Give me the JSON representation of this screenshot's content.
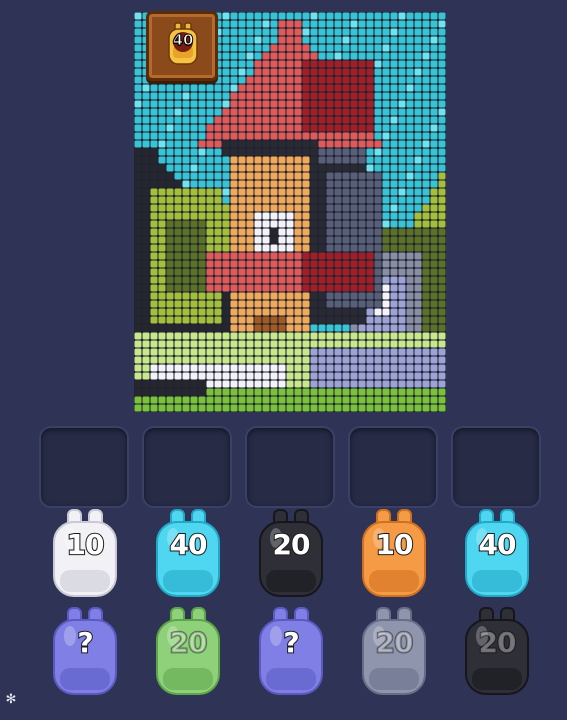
{
  "target": {
    "count": "40"
  },
  "palette": {
    "sky": "#37c4d4",
    "skyHi": "#6fe3ee",
    "roof": "#e05a5a",
    "darkRoof": "#a21f28",
    "tower": "#f3a95a",
    "darkTower": "#2a2a33",
    "stoneGray": "#8a8fa3",
    "shadowGray": "#5a5f78",
    "lightPurple": "#9ea3d6",
    "white": "#f4f4f8",
    "olive": "#a4c03a",
    "darkOlive": "#5b7226",
    "lightGreen": "#c7e98a",
    "grass": "#7ac23a",
    "black": "#26262e",
    "brown": "#a05a22"
  },
  "slots": [
    {
      "state": "empty"
    },
    {
      "state": "empty"
    },
    {
      "state": "empty"
    },
    {
      "state": "empty"
    },
    {
      "state": "empty"
    }
  ],
  "bags_row1": [
    {
      "label": "10",
      "color": "#f2f2f6",
      "shade": "#c9c9d6"
    },
    {
      "label": "40",
      "color": "#4fd6f0",
      "shade": "#22a7c4"
    },
    {
      "label": "20",
      "color": "#2f2f38",
      "shade": "#16161c"
    },
    {
      "label": "10",
      "color": "#f59a45",
      "shade": "#d0701f"
    },
    {
      "label": "40",
      "color": "#4fd6f0",
      "shade": "#22a7c4"
    }
  ],
  "bags_row2": [
    {
      "label": "?",
      "color": "#7f7fe6",
      "shade": "#5a5ac2",
      "kind": "mystery"
    },
    {
      "label": "20",
      "color": "#8fd07a",
      "shade": "#5ea44a",
      "kind": "locked"
    },
    {
      "label": "?",
      "color": "#7f7fe6",
      "shade": "#5a5ac2",
      "kind": "mystery"
    },
    {
      "label": "20",
      "color": "#8f95ad",
      "shade": "#676d86",
      "kind": "locked"
    },
    {
      "label": "20",
      "color": "#2f2f38",
      "shade": "#16161c",
      "kind": "locked"
    }
  ]
}
